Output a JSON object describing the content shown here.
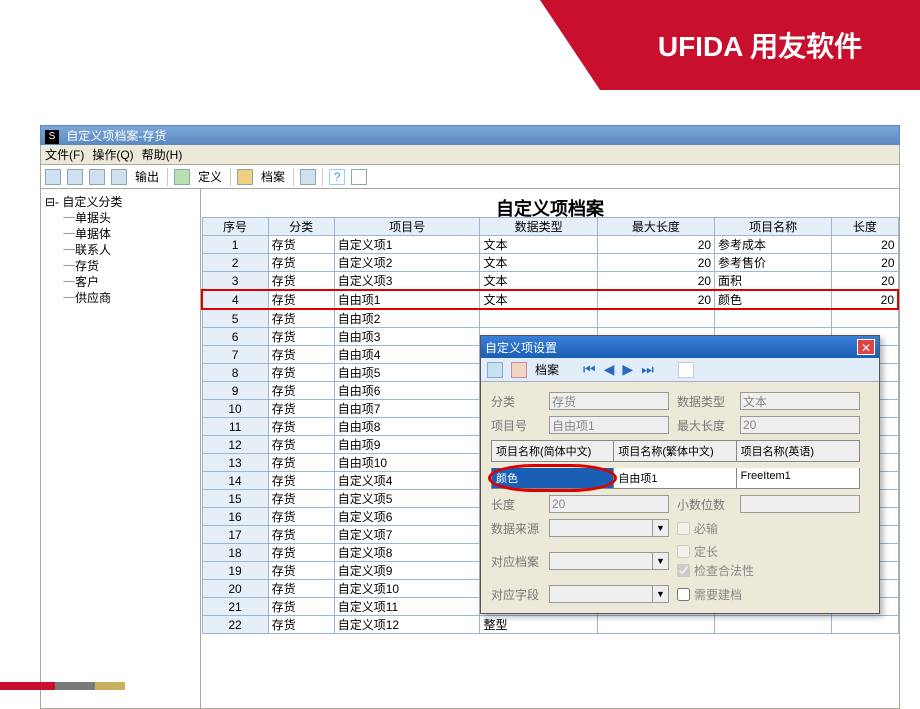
{
  "banner": "UFIDA 用友软件",
  "window_title": "自定义项档案-存货",
  "menus": {
    "file": "文件(F)",
    "operate": "操作(Q)",
    "help": "帮助(H)"
  },
  "toolbar": {
    "export": "输出",
    "define": "定义",
    "archive": "档案"
  },
  "tree": {
    "root": "自定义分类",
    "items": [
      "单据头",
      "单据体",
      "联系人",
      "存货",
      "客户",
      "供应商"
    ]
  },
  "grid_title": "自定义项档案",
  "grid_headers": [
    "序号",
    "分类",
    "项目号",
    "数据类型",
    "最大长度",
    "项目名称",
    "长度"
  ],
  "grid_rows": [
    {
      "no": 1,
      "cat": "存货",
      "pid": "自定义项1",
      "dtype": "文本",
      "maxlen": 20,
      "name": "参考成本",
      "len": 20
    },
    {
      "no": 2,
      "cat": "存货",
      "pid": "自定义项2",
      "dtype": "文本",
      "maxlen": 20,
      "name": "参考售价",
      "len": 20
    },
    {
      "no": 3,
      "cat": "存货",
      "pid": "自定义项3",
      "dtype": "文本",
      "maxlen": 20,
      "name": "面积",
      "len": 20
    },
    {
      "no": 4,
      "cat": "存货",
      "pid": "自由项1",
      "dtype": "文本",
      "maxlen": 20,
      "name": "颜色",
      "len": 20,
      "highlight": true
    },
    {
      "no": 5,
      "cat": "存货",
      "pid": "自由项2",
      "dtype": "",
      "maxlen": "",
      "name": "",
      "len": ""
    },
    {
      "no": 6,
      "cat": "存货",
      "pid": "自由项3",
      "dtype": "",
      "maxlen": "",
      "name": "",
      "len": ""
    },
    {
      "no": 7,
      "cat": "存货",
      "pid": "自由项4",
      "dtype": "",
      "maxlen": "",
      "name": "",
      "len": ""
    },
    {
      "no": 8,
      "cat": "存货",
      "pid": "自由项5",
      "dtype": "",
      "maxlen": "",
      "name": "",
      "len": ""
    },
    {
      "no": 9,
      "cat": "存货",
      "pid": "自由项6",
      "dtype": "",
      "maxlen": "",
      "name": "",
      "len": ""
    },
    {
      "no": 10,
      "cat": "存货",
      "pid": "自由项7",
      "dtype": "",
      "maxlen": "",
      "name": "",
      "len": ""
    },
    {
      "no": 11,
      "cat": "存货",
      "pid": "自由项8",
      "dtype": "",
      "maxlen": "",
      "name": "",
      "len": ""
    },
    {
      "no": 12,
      "cat": "存货",
      "pid": "自由项9",
      "dtype": "",
      "maxlen": "",
      "name": "",
      "len": ""
    },
    {
      "no": 13,
      "cat": "存货",
      "pid": "自由项10",
      "dtype": "",
      "maxlen": "",
      "name": "",
      "len": ""
    },
    {
      "no": 14,
      "cat": "存货",
      "pid": "自定义项4",
      "dtype": "",
      "maxlen": "",
      "name": "",
      "len": ""
    },
    {
      "no": 15,
      "cat": "存货",
      "pid": "自定义项5",
      "dtype": "",
      "maxlen": "",
      "name": "",
      "len": ""
    },
    {
      "no": 16,
      "cat": "存货",
      "pid": "自定义项6",
      "dtype": "",
      "maxlen": "",
      "name": "",
      "len": ""
    },
    {
      "no": 17,
      "cat": "存货",
      "pid": "自定义项7",
      "dtype": "",
      "maxlen": "",
      "name": "",
      "len": ""
    },
    {
      "no": 18,
      "cat": "存货",
      "pid": "自定义项8",
      "dtype": "",
      "maxlen": "",
      "name": "",
      "len": ""
    },
    {
      "no": 19,
      "cat": "存货",
      "pid": "自定义项9",
      "dtype": "",
      "maxlen": "",
      "name": "",
      "len": ""
    },
    {
      "no": 20,
      "cat": "存货",
      "pid": "自定义项10",
      "dtype": "",
      "maxlen": "",
      "name": "",
      "len": ""
    },
    {
      "no": 21,
      "cat": "存货",
      "pid": "自定义项11",
      "dtype": "",
      "maxlen": "",
      "name": "",
      "len": ""
    },
    {
      "no": 22,
      "cat": "存货",
      "pid": "自定义项12",
      "dtype": "整型",
      "maxlen": "",
      "name": "",
      "len": ""
    }
  ],
  "dialog": {
    "title": "自定义项设置",
    "archive_btn": "档案",
    "labels": {
      "category": "分类",
      "datatype": "数据类型",
      "projectid": "项目号",
      "maxlen": "最大长度",
      "length": "长度",
      "decimal": "小数位数",
      "datasource": "数据来源",
      "refarchive": "对应档案",
      "reffield": "对应字段"
    },
    "values": {
      "category": "存货",
      "datatype": "文本",
      "projectid": "自由项1",
      "maxlen": "20",
      "length": "20"
    },
    "name_headers": {
      "zhcn": "项目名称(简体中文)",
      "zhtw": "项目名称(繁体中文)",
      "en": "项目名称(英语)"
    },
    "name_values": {
      "zhcn": "颜色",
      "zhtw": "自由项1",
      "en": "FreeItem1"
    },
    "checks": {
      "required": "必输",
      "fixedlen": "定长",
      "validate": "检查合法性",
      "needarchive": "需要建档"
    }
  }
}
